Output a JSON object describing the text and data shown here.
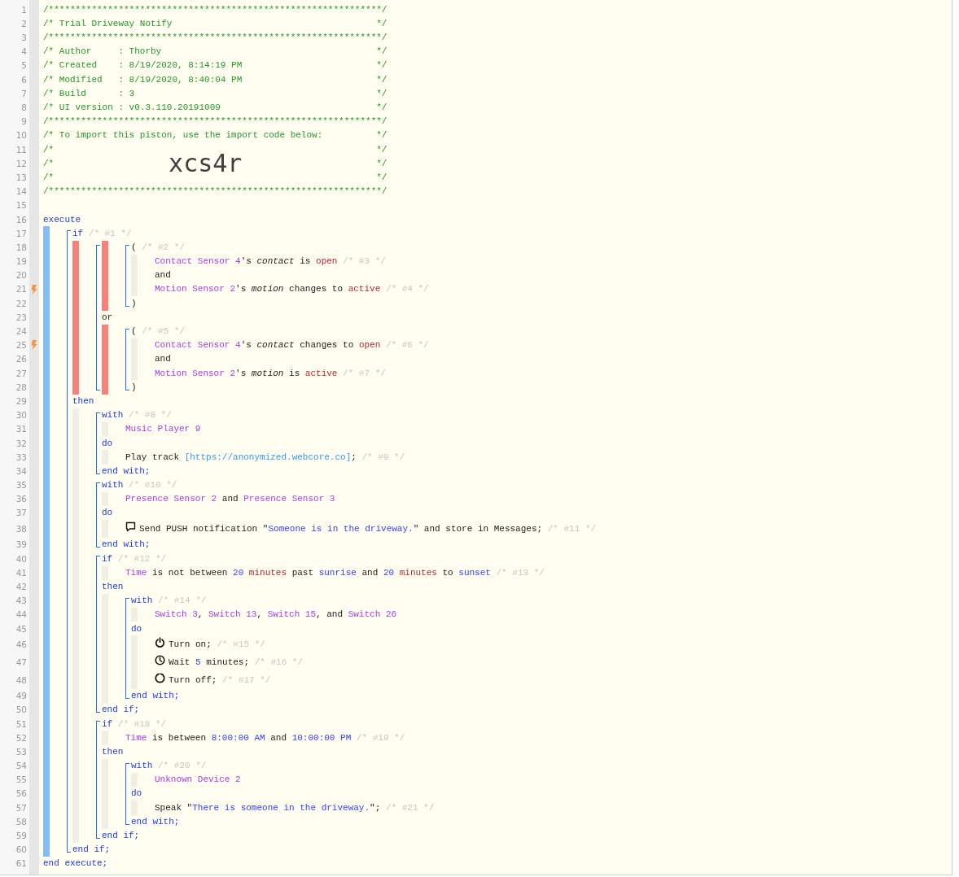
{
  "editor": {
    "children": [
      {
        "kind": "banner",
        "n": "1",
        "tokens": [
          {
            "kind": "comment",
            "text": "/**************************************************************/"
          }
        ]
      },
      {
        "kind": "banner",
        "n": "2",
        "tokens": [
          {
            "kind": "comment",
            "text": "/* Trial Driveway Notify"
          },
          {
            "kind": "comment",
            "text": "*/"
          }
        ]
      },
      {
        "kind": "banner",
        "n": "3",
        "tokens": [
          {
            "kind": "comment",
            "text": "/**************************************************************/"
          }
        ]
      },
      {
        "kind": "banner",
        "n": "4",
        "tokens": [
          {
            "kind": "comment",
            "text": "/* Author     : Thorby"
          },
          {
            "kind": "comment",
            "text": "*/"
          }
        ]
      },
      {
        "kind": "banner",
        "n": "5",
        "tokens": [
          {
            "kind": "comment",
            "text": "/* Created    : 8/19/2020, 8:14:19 PM"
          },
          {
            "kind": "comment",
            "text": "*/"
          }
        ]
      },
      {
        "kind": "banner",
        "n": "6",
        "tokens": [
          {
            "kind": "comment",
            "text": "/* Modified   : 8/19/2020, 8:40:04 PM"
          },
          {
            "kind": "comment",
            "text": "*/"
          }
        ]
      },
      {
        "kind": "banner",
        "n": "7",
        "tokens": [
          {
            "kind": "comment",
            "text": "/* Build      : 3"
          },
          {
            "kind": "comment",
            "text": "*/"
          }
        ]
      },
      {
        "kind": "banner",
        "n": "8",
        "tokens": [
          {
            "kind": "comment",
            "text": "/* UI version : v0.3.110.20191009"
          },
          {
            "kind": "comment",
            "text": "*/"
          }
        ]
      },
      {
        "kind": "banner",
        "n": "9",
        "tokens": [
          {
            "kind": "comment",
            "text": "/**************************************************************/"
          }
        ]
      },
      {
        "kind": "banner",
        "n": "10",
        "tokens": [
          {
            "kind": "comment",
            "text": "/* To import this piston, use the import code below:"
          },
          {
            "kind": "comment",
            "text": "*/"
          }
        ]
      },
      {
        "kind": "banner",
        "n": "11",
        "tokens": [
          {
            "kind": "comment",
            "text": "/*"
          },
          {
            "kind": "comment",
            "text": "*/"
          }
        ]
      },
      {
        "kind": "banner",
        "n": "12",
        "tokens": [
          {
            "kind": "comment",
            "text": "/*"
          },
          {
            "kind": "big",
            "text": "xcs4r"
          },
          {
            "kind": "comment",
            "text": "*/"
          }
        ]
      },
      {
        "kind": "banner",
        "n": "13",
        "tokens": [
          {
            "kind": "comment",
            "text": "/*"
          },
          {
            "kind": "comment",
            "text": "*/"
          }
        ]
      },
      {
        "kind": "banner",
        "n": "14",
        "tokens": [
          {
            "kind": "comment",
            "text": "/**************************************************************/"
          }
        ]
      },
      {
        "kind": "code",
        "n": "15"
      },
      {
        "kind": "code",
        "n": "16",
        "tokens": [
          {
            "kind": "kw",
            "text": "execute"
          }
        ]
      },
      {
        "kind": "section",
        "color": "#82bdf6",
        "children": [
          {
            "kind": "statement",
            "children": [
              {
                "kind": "code",
                "n": "17",
                "tokens": [
                  {
                    "kind": "kw",
                    "text": "if"
                  },
                  {
                    "kind": "note",
                    "text": " /* #1 */"
                  }
                ]
              },
              {
                "kind": "section",
                "color": "#f8807a",
                "children": [
                  {
                    "kind": "statement",
                    "children": [
                      {
                        "kind": "section",
                        "color": "#f8807a",
                        "children": [
                          {
                            "kind": "statement",
                            "children": [
                              {
                                "kind": "code",
                                "n": "18",
                                "tokens": [
                                  {
                                    "kind": "plain",
                                    "text": "( "
                                  },
                                  {
                                    "kind": "note",
                                    "text": "/* #2 */"
                                  }
                                ]
                              },
                              {
                                "kind": "section",
                                "color": "#f1eee3",
                                "children": [
                                  {
                                    "kind": "code",
                                    "n": "19",
                                    "tokens": [
                                      {
                                        "kind": "device",
                                        "text": "Contact Sensor 4"
                                      },
                                      {
                                        "kind": "plain",
                                        "text": "'s "
                                      },
                                      {
                                        "kind": "attribute",
                                        "text": "contact"
                                      },
                                      {
                                        "kind": "plain",
                                        "text": " is "
                                      },
                                      {
                                        "kind": "value",
                                        "text": "open"
                                      },
                                      {
                                        "kind": "note",
                                        "text": " /* #3 */"
                                      }
                                    ]
                                  },
                                  {
                                    "kind": "code",
                                    "n": "20",
                                    "tokens": [
                                      {
                                        "kind": "plain",
                                        "text": "and"
                                      }
                                    ]
                                  },
                                  {
                                    "kind": "code",
                                    "n": "21",
                                    "trigger": true,
                                    "tokens": [
                                      {
                                        "kind": "device",
                                        "text": "Motion Sensor 2"
                                      },
                                      {
                                        "kind": "plain",
                                        "text": "'s "
                                      },
                                      {
                                        "kind": "attribute",
                                        "text": "motion"
                                      },
                                      {
                                        "kind": "plain",
                                        "text": " changes to "
                                      },
                                      {
                                        "kind": "value",
                                        "text": "active"
                                      },
                                      {
                                        "kind": "note",
                                        "text": " /* #4 */"
                                      }
                                    ]
                                  }
                                ]
                              },
                              {
                                "kind": "code",
                                "n": "22",
                                "tokens": [
                                  {
                                    "kind": "plain",
                                    "text": ")"
                                  }
                                ]
                              }
                            ]
                          }
                        ]
                      },
                      {
                        "kind": "code",
                        "n": "23",
                        "tokens": [
                          {
                            "kind": "plain",
                            "text": "or"
                          }
                        ]
                      },
                      {
                        "kind": "section",
                        "color": "#f8807a",
                        "children": [
                          {
                            "kind": "statement",
                            "children": [
                              {
                                "kind": "code",
                                "n": "24",
                                "tokens": [
                                  {
                                    "kind": "plain",
                                    "text": "( "
                                  },
                                  {
                                    "kind": "note",
                                    "text": "/* #5 */"
                                  }
                                ]
                              },
                              {
                                "kind": "section",
                                "color": "#f1eee3",
                                "children": [
                                  {
                                    "kind": "code",
                                    "n": "25",
                                    "trigger": true,
                                    "tokens": [
                                      {
                                        "kind": "device",
                                        "text": "Contact Sensor 4"
                                      },
                                      {
                                        "kind": "plain",
                                        "text": "'s "
                                      },
                                      {
                                        "kind": "attribute",
                                        "text": "contact"
                                      },
                                      {
                                        "kind": "plain",
                                        "text": " changes to "
                                      },
                                      {
                                        "kind": "value",
                                        "text": "open"
                                      },
                                      {
                                        "kind": "note",
                                        "text": " /* #6 */"
                                      }
                                    ]
                                  },
                                  {
                                    "kind": "code",
                                    "n": "26",
                                    "tokens": [
                                      {
                                        "kind": "plain",
                                        "text": "and"
                                      }
                                    ]
                                  },
                                  {
                                    "kind": "code",
                                    "n": "27",
                                    "tokens": [
                                      {
                                        "kind": "device",
                                        "text": "Motion Sensor 2"
                                      },
                                      {
                                        "kind": "plain",
                                        "text": "'s "
                                      },
                                      {
                                        "kind": "attribute",
                                        "text": "motion"
                                      },
                                      {
                                        "kind": "plain",
                                        "text": " is "
                                      },
                                      {
                                        "kind": "value",
                                        "text": "active"
                                      },
                                      {
                                        "kind": "note",
                                        "text": " /* #7 */"
                                      }
                                    ]
                                  }
                                ]
                              },
                              {
                                "kind": "code",
                                "n": "28",
                                "tokens": [
                                  {
                                    "kind": "plain",
                                    "text": ")"
                                  }
                                ]
                              }
                            ]
                          }
                        ]
                      }
                    ]
                  }
                ]
              },
              {
                "kind": "code",
                "n": "29",
                "tokens": [
                  {
                    "kind": "kw",
                    "text": "then"
                  }
                ]
              },
              {
                "kind": "section",
                "color": "#f1eee3",
                "children": [
                  {
                    "kind": "statement",
                    "children": [
                      {
                        "kind": "code",
                        "n": "30",
                        "tokens": [
                          {
                            "kind": "kw",
                            "text": "with"
                          },
                          {
                            "kind": "note",
                            "text": " /* #8 */"
                          }
                        ]
                      },
                      {
                        "kind": "section",
                        "color": "#f1eee3",
                        "children": [
                          {
                            "kind": "code",
                            "n": "31",
                            "tokens": [
                              {
                                "kind": "device",
                                "text": "Music Player 9"
                              }
                            ]
                          }
                        ]
                      },
                      {
                        "kind": "code",
                        "n": "32",
                        "tokens": [
                          {
                            "kind": "kw",
                            "text": "do"
                          }
                        ]
                      },
                      {
                        "kind": "section",
                        "color": "#f1eee3",
                        "children": [
                          {
                            "kind": "code",
                            "n": "33",
                            "tokens": [
                              {
                                "kind": "plain",
                                "text": "Play track "
                              },
                              {
                                "kind": "link",
                                "text": "[https://anonymized.webcore.co]"
                              },
                              {
                                "kind": "plain",
                                "text": "; "
                              },
                              {
                                "kind": "note",
                                "text": "/* #9 */"
                              }
                            ]
                          }
                        ]
                      },
                      {
                        "kind": "code",
                        "n": "34",
                        "tokens": [
                          {
                            "kind": "kw",
                            "text": "end with;"
                          }
                        ]
                      }
                    ]
                  },
                  {
                    "kind": "statement",
                    "children": [
                      {
                        "kind": "code",
                        "n": "35",
                        "tokens": [
                          {
                            "kind": "kw",
                            "text": "with"
                          },
                          {
                            "kind": "note",
                            "text": " /* #10 */"
                          }
                        ]
                      },
                      {
                        "kind": "section",
                        "color": "#f1eee3",
                        "children": [
                          {
                            "kind": "code",
                            "n": "36",
                            "tokens": [
                              {
                                "kind": "device",
                                "text": "Presence Sensor 2"
                              },
                              {
                                "kind": "plain",
                                "text": " and "
                              },
                              {
                                "kind": "device",
                                "text": "Presence Sensor 3"
                              }
                            ]
                          }
                        ]
                      },
                      {
                        "kind": "code",
                        "n": "37",
                        "tokens": [
                          {
                            "kind": "kw",
                            "text": "do"
                          }
                        ]
                      },
                      {
                        "kind": "section",
                        "color": "#f1eee3",
                        "children": [
                          {
                            "kind": "code",
                            "n": "38",
                            "tokens": [
                              {
                                "kind": "bubble"
                              },
                              {
                                "kind": "plain",
                                "text": "Send PUSH notification \""
                              },
                              {
                                "kind": "string",
                                "text": "Someone is in the driveway."
                              },
                              {
                                "kind": "plain",
                                "text": "\" and store in Messages; "
                              },
                              {
                                "kind": "note",
                                "text": "/* #11 */"
                              }
                            ]
                          }
                        ]
                      },
                      {
                        "kind": "code",
                        "n": "39",
                        "tokens": [
                          {
                            "kind": "kw",
                            "text": "end with;"
                          }
                        ]
                      }
                    ]
                  },
                  {
                    "kind": "statement",
                    "children": [
                      {
                        "kind": "code",
                        "n": "40",
                        "tokens": [
                          {
                            "kind": "kw",
                            "text": "if"
                          },
                          {
                            "kind": "note",
                            "text": " /* #12 */"
                          }
                        ]
                      },
                      {
                        "kind": "section",
                        "color": "#f1eee3",
                        "children": [
                          {
                            "kind": "code",
                            "n": "41",
                            "tokens": [
                              {
                                "kind": "device",
                                "text": "Time"
                              },
                              {
                                "kind": "plain",
                                "text": " is not between "
                              },
                              {
                                "kind": "number",
                                "text": "20"
                              },
                              {
                                "kind": "value",
                                "text": " minutes"
                              },
                              {
                                "kind": "plain",
                                "text": " past "
                              },
                              {
                                "kind": "number",
                                "text": "sunrise"
                              },
                              {
                                "kind": "plain",
                                "text": " and "
                              },
                              {
                                "kind": "number",
                                "text": "20"
                              },
                              {
                                "kind": "value",
                                "text": " minutes"
                              },
                              {
                                "kind": "plain",
                                "text": " to "
                              },
                              {
                                "kind": "number",
                                "text": "sunset"
                              },
                              {
                                "kind": "note",
                                "text": " /* #13 */"
                              }
                            ]
                          }
                        ]
                      },
                      {
                        "kind": "code",
                        "n": "42",
                        "tokens": [
                          {
                            "kind": "kw",
                            "text": "then"
                          }
                        ]
                      },
                      {
                        "kind": "section",
                        "color": "#f1eee3",
                        "children": [
                          {
                            "kind": "statement",
                            "children": [
                              {
                                "kind": "code",
                                "n": "43",
                                "tokens": [
                                  {
                                    "kind": "kw",
                                    "text": "with"
                                  },
                                  {
                                    "kind": "note",
                                    "text": " /* #14 */"
                                  }
                                ]
                              },
                              {
                                "kind": "section",
                                "color": "#f1eee3",
                                "children": [
                                  {
                                    "kind": "code",
                                    "n": "44",
                                    "tokens": [
                                      {
                                        "kind": "device",
                                        "text": "Switch 3"
                                      },
                                      {
                                        "kind": "plain",
                                        "text": ", "
                                      },
                                      {
                                        "kind": "device",
                                        "text": "Switch 13"
                                      },
                                      {
                                        "kind": "plain",
                                        "text": ", "
                                      },
                                      {
                                        "kind": "device",
                                        "text": "Switch 15"
                                      },
                                      {
                                        "kind": "plain",
                                        "text": ", and "
                                      },
                                      {
                                        "kind": "device",
                                        "text": "Switch 26"
                                      }
                                    ]
                                  }
                                ]
                              },
                              {
                                "kind": "code",
                                "n": "45",
                                "tokens": [
                                  {
                                    "kind": "kw",
                                    "text": "do"
                                  }
                                ]
                              },
                              {
                                "kind": "section",
                                "color": "#f1eee3",
                                "children": [
                                  {
                                    "kind": "code",
                                    "n": "46",
                                    "tokens": [
                                      {
                                        "kind": "power"
                                      },
                                      {
                                        "kind": "plain",
                                        "text": "Turn on; "
                                      },
                                      {
                                        "kind": "note",
                                        "text": "/* #15 */"
                                      }
                                    ]
                                  },
                                  {
                                    "kind": "code",
                                    "n": "47",
                                    "tokens": [
                                      {
                                        "kind": "clock"
                                      },
                                      {
                                        "kind": "plain",
                                        "text": "Wait "
                                      },
                                      {
                                        "kind": "number",
                                        "text": "5"
                                      },
                                      {
                                        "kind": "plain",
                                        "text": " minutes; "
                                      },
                                      {
                                        "kind": "note",
                                        "text": "/* #16 */"
                                      }
                                    ]
                                  },
                                  {
                                    "kind": "code",
                                    "n": "48",
                                    "tokens": [
                                      {
                                        "kind": "ring"
                                      },
                                      {
                                        "kind": "plain",
                                        "text": "Turn off; "
                                      },
                                      {
                                        "kind": "note",
                                        "text": "/* #17 */"
                                      }
                                    ]
                                  }
                                ]
                              },
                              {
                                "kind": "code",
                                "n": "49",
                                "tokens": [
                                  {
                                    "kind": "kw",
                                    "text": "end with;"
                                  }
                                ]
                              }
                            ]
                          }
                        ]
                      },
                      {
                        "kind": "code",
                        "n": "50",
                        "tokens": [
                          {
                            "kind": "kw",
                            "text": "end if;"
                          }
                        ]
                      }
                    ]
                  },
                  {
                    "kind": "statement",
                    "children": [
                      {
                        "kind": "code",
                        "n": "51",
                        "tokens": [
                          {
                            "kind": "kw",
                            "text": "if"
                          },
                          {
                            "kind": "note",
                            "text": " /* #18 */"
                          }
                        ]
                      },
                      {
                        "kind": "section",
                        "color": "#f1eee3",
                        "children": [
                          {
                            "kind": "code",
                            "n": "52",
                            "tokens": [
                              {
                                "kind": "device",
                                "text": "Time"
                              },
                              {
                                "kind": "plain",
                                "text": " is between "
                              },
                              {
                                "kind": "number",
                                "text": "8:00:00 AM"
                              },
                              {
                                "kind": "plain",
                                "text": " and "
                              },
                              {
                                "kind": "number",
                                "text": "10:00:00 PM"
                              },
                              {
                                "kind": "note",
                                "text": " /* #19 */"
                              }
                            ]
                          }
                        ]
                      },
                      {
                        "kind": "code",
                        "n": "53",
                        "tokens": [
                          {
                            "kind": "kw",
                            "text": "then"
                          }
                        ]
                      },
                      {
                        "kind": "section",
                        "color": "#f1eee3",
                        "children": [
                          {
                            "kind": "statement",
                            "children": [
                              {
                                "kind": "code",
                                "n": "54",
                                "tokens": [
                                  {
                                    "kind": "kw",
                                    "text": "with"
                                  },
                                  {
                                    "kind": "note",
                                    "text": " /* #20 */"
                                  }
                                ]
                              },
                              {
                                "kind": "section",
                                "color": "#f1eee3",
                                "children": [
                                  {
                                    "kind": "code",
                                    "n": "55",
                                    "tokens": [
                                      {
                                        "kind": "device",
                                        "text": "Unknown Device 2"
                                      }
                                    ]
                                  }
                                ]
                              },
                              {
                                "kind": "code",
                                "n": "56",
                                "tokens": [
                                  {
                                    "kind": "kw",
                                    "text": "do"
                                  }
                                ]
                              },
                              {
                                "kind": "section",
                                "color": "#f1eee3",
                                "children": [
                                  {
                                    "kind": "code",
                                    "n": "57",
                                    "tokens": [
                                      {
                                        "kind": "plain",
                                        "text": "Speak \""
                                      },
                                      {
                                        "kind": "string",
                                        "text": "There is someone in the driveway."
                                      },
                                      {
                                        "kind": "plain",
                                        "text": "\"; "
                                      },
                                      {
                                        "kind": "note",
                                        "text": "/* #21 */"
                                      }
                                    ]
                                  }
                                ]
                              },
                              {
                                "kind": "code",
                                "n": "58",
                                "tokens": [
                                  {
                                    "kind": "kw",
                                    "text": "end with;"
                                  }
                                ]
                              }
                            ]
                          }
                        ]
                      },
                      {
                        "kind": "code",
                        "n": "59",
                        "tokens": [
                          {
                            "kind": "kw",
                            "text": "end if;"
                          }
                        ]
                      }
                    ]
                  }
                ]
              },
              {
                "kind": "code",
                "n": "60",
                "tokens": [
                  {
                    "kind": "kw",
                    "text": "end if;"
                  }
                ]
              }
            ]
          }
        ]
      },
      {
        "kind": "code",
        "n": "61",
        "tokens": [
          {
            "kind": "kw",
            "text": "end execute;"
          }
        ]
      }
    ]
  }
}
